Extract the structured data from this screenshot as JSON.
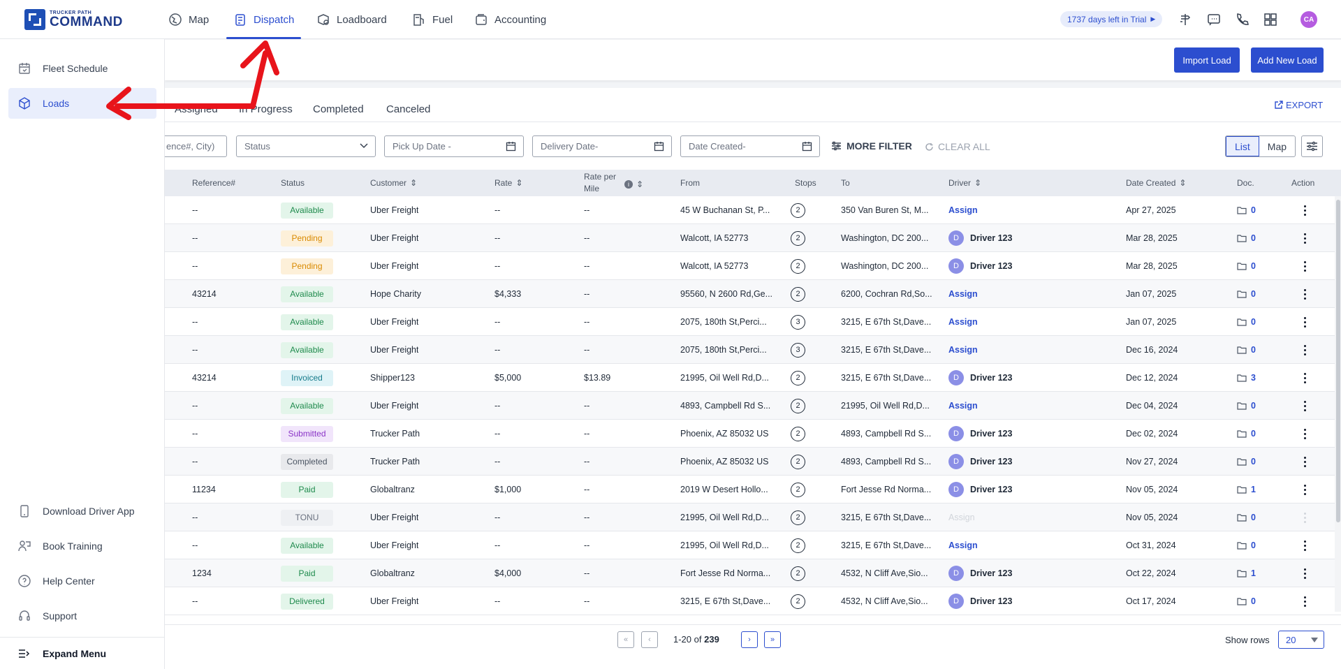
{
  "app": {
    "logo_small": "TRUCKER PATH",
    "logo_big": "COMMAND",
    "trial": "1737 days left in Trial",
    "avatar": "CA"
  },
  "nav": {
    "map": "Map",
    "dispatch": "Dispatch",
    "loadboard": "Loadboard",
    "fuel": "Fuel",
    "accounting": "Accounting"
  },
  "sidebar": {
    "fleet_schedule": "Fleet Schedule",
    "loads": "Loads",
    "download_app": "Download Driver App",
    "book_training": "Book Training",
    "help_center": "Help Center",
    "support": "Support",
    "expand_menu": "Expand Menu"
  },
  "actions": {
    "import": "Import Load",
    "add": "Add New Load"
  },
  "tabs": {
    "assigned": "Assigned",
    "in_progress": "In Progress",
    "completed": "Completed",
    "canceled": "Canceled",
    "export": "EXPORT"
  },
  "filters": {
    "search_placeholder": "ence#, City)",
    "status": "Status",
    "pickup": "Pick Up Date -",
    "delivery": "Delivery Date-",
    "created": "Date Created-",
    "more": "MORE FILTER",
    "clear": "CLEAR ALL",
    "view_list": "List",
    "view_map": "Map"
  },
  "columns": {
    "ref": "Reference#",
    "status": "Status",
    "customer": "Customer",
    "rate": "Rate",
    "rpm1": "Rate per",
    "rpm2": "Mile",
    "from": "From",
    "stops": "Stops",
    "to": "To",
    "driver": "Driver",
    "created": "Date Created",
    "doc": "Doc.",
    "action": "Action"
  },
  "rows": [
    {
      "ref": "--",
      "status": "Available",
      "customer": "Uber Freight",
      "rate": "--",
      "rpm": "--",
      "from": "45 W Buchanan St, P...",
      "stops": "2",
      "to": "350 Van Buren St, M...",
      "driver": "Assign",
      "assigned": false,
      "date": "Apr 27, 2025",
      "doc": "0"
    },
    {
      "ref": "--",
      "status": "Pending",
      "customer": "Uber Freight",
      "rate": "--",
      "rpm": "--",
      "from": "Walcott, IA 52773",
      "stops": "2",
      "to": "Washington, DC 200...",
      "driver": "Driver 123",
      "assigned": true,
      "date": "Mar 28, 2025",
      "doc": "0"
    },
    {
      "ref": "--",
      "status": "Pending",
      "customer": "Uber Freight",
      "rate": "--",
      "rpm": "--",
      "from": "Walcott, IA 52773",
      "stops": "2",
      "to": "Washington, DC 200...",
      "driver": "Driver 123",
      "assigned": true,
      "date": "Mar 28, 2025",
      "doc": "0"
    },
    {
      "ref": "43214",
      "status": "Available",
      "customer": "Hope Charity",
      "rate": "$4,333",
      "rpm": "--",
      "from": "95560, N 2600 Rd,Ge...",
      "stops": "2",
      "to": "6200, Cochran Rd,So...",
      "driver": "Assign",
      "assigned": false,
      "date": "Jan 07, 2025",
      "doc": "0"
    },
    {
      "ref": "--",
      "status": "Available",
      "customer": "Uber Freight",
      "rate": "--",
      "rpm": "--",
      "from": "2075, 180th St,Perci...",
      "stops": "3",
      "to": "3215, E 67th St,Dave...",
      "driver": "Assign",
      "assigned": false,
      "date": "Jan 07, 2025",
      "doc": "0"
    },
    {
      "ref": "--",
      "status": "Available",
      "customer": "Uber Freight",
      "rate": "--",
      "rpm": "--",
      "from": "2075, 180th St,Perci...",
      "stops": "3",
      "to": "3215, E 67th St,Dave...",
      "driver": "Assign",
      "assigned": false,
      "date": "Dec 16, 2024",
      "doc": "0"
    },
    {
      "ref": "43214",
      "status": "Invoiced",
      "customer": "Shipper123",
      "rate": "$5,000",
      "rpm": "$13.89",
      "from": "21995, Oil Well Rd,D...",
      "stops": "2",
      "to": "3215, E 67th St,Dave...",
      "driver": "Driver 123",
      "assigned": true,
      "date": "Dec 12, 2024",
      "doc": "3"
    },
    {
      "ref": "--",
      "status": "Available",
      "customer": "Uber Freight",
      "rate": "--",
      "rpm": "--",
      "from": "4893, Campbell Rd S...",
      "stops": "2",
      "to": "21995, Oil Well Rd,D...",
      "driver": "Assign",
      "assigned": false,
      "date": "Dec 04, 2024",
      "doc": "0"
    },
    {
      "ref": "--",
      "status": "Submitted",
      "customer": "Trucker Path",
      "rate": "--",
      "rpm": "--",
      "from": "Phoenix, AZ 85032 US",
      "stops": "2",
      "to": "4893, Campbell Rd S...",
      "driver": "Driver 123",
      "assigned": true,
      "date": "Dec 02, 2024",
      "doc": "0"
    },
    {
      "ref": "--",
      "status": "Completed",
      "customer": "Trucker Path",
      "rate": "--",
      "rpm": "--",
      "from": "Phoenix, AZ 85032 US",
      "stops": "2",
      "to": "4893, Campbell Rd S...",
      "driver": "Driver 123",
      "assigned": true,
      "date": "Nov 27, 2024",
      "doc": "0"
    },
    {
      "ref": "11234",
      "status": "Paid",
      "customer": "Globaltranz",
      "rate": "$1,000",
      "rpm": "--",
      "from": "2019 W Desert Hollo...",
      "stops": "2",
      "to": "Fort Jesse Rd Norma...",
      "driver": "Driver 123",
      "assigned": true,
      "date": "Nov 05, 2024",
      "doc": "1"
    },
    {
      "ref": "--",
      "status": "TONU",
      "customer": "Uber Freight",
      "rate": "--",
      "rpm": "--",
      "from": "21995, Oil Well Rd,D...",
      "stops": "2",
      "to": "3215, E 67th St,Dave...",
      "driver": "Assign",
      "assigned": false,
      "disabled": true,
      "date": "Nov 05, 2024",
      "doc": "0"
    },
    {
      "ref": "--",
      "status": "Available",
      "customer": "Uber Freight",
      "rate": "--",
      "rpm": "--",
      "from": "21995, Oil Well Rd,D...",
      "stops": "2",
      "to": "3215, E 67th St,Dave...",
      "driver": "Assign",
      "assigned": false,
      "date": "Oct 31, 2024",
      "doc": "0"
    },
    {
      "ref": "1234",
      "status": "Paid",
      "customer": "Globaltranz",
      "rate": "$4,000",
      "rpm": "--",
      "from": "Fort Jesse Rd Norma...",
      "stops": "2",
      "to": "4532, N Cliff Ave,Sio...",
      "driver": "Driver 123",
      "assigned": true,
      "date": "Oct 22, 2024",
      "doc": "1"
    },
    {
      "ref": "--",
      "status": "Delivered",
      "customer": "Uber Freight",
      "rate": "--",
      "rpm": "--",
      "from": "3215, E 67th St,Dave...",
      "stops": "2",
      "to": "4532, N Cliff Ave,Sio...",
      "driver": "Driver 123",
      "assigned": true,
      "date": "Oct 17, 2024",
      "doc": "0"
    }
  ],
  "driver_initial": "D",
  "pagination": {
    "range": "1-20 of",
    "total": "239",
    "show_rows": "Show rows",
    "rows_value": "20"
  },
  "status_colors": {
    "Available": [
      "#e3f5ea",
      "#1e8a4c"
    ],
    "Pending": [
      "#fdf0d9",
      "#d98a00"
    ],
    "Invoiced": [
      "#dff3f7",
      "#147a8a"
    ],
    "Submitted": [
      "#f1e5fb",
      "#8a33c7"
    ],
    "Completed": [
      "#e8e9ec",
      "#4b5563"
    ],
    "Paid": [
      "#e3f5ea",
      "#1e8a4c"
    ],
    "TONU": [
      "#eef0f3",
      "#6b7280"
    ],
    "Delivered": [
      "#e3f5ea",
      "#1e8a4c"
    ]
  },
  "accent": "#2c4ecf",
  "annotation_color": "#e8141b"
}
